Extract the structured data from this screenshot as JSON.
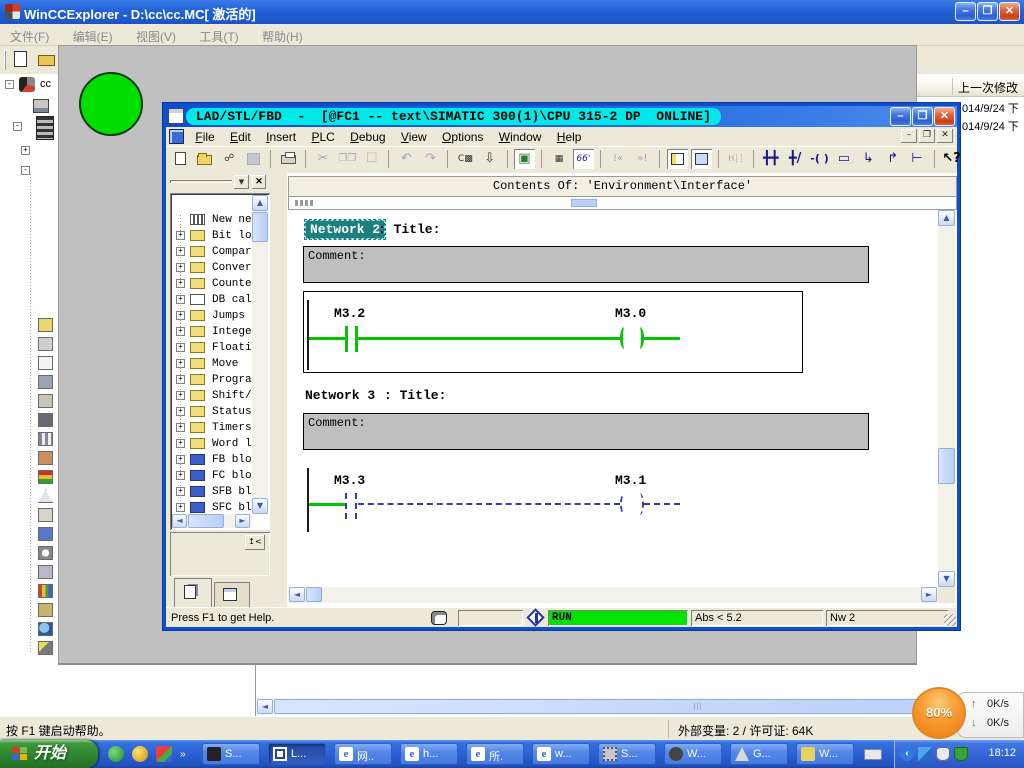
{
  "wincc": {
    "title": "WinCCExplorer - D:\\cc\\cc.MC[ 激活的]",
    "menus": [
      "文件(F)",
      "编辑(E)",
      "视图(V)",
      "工具(T)",
      "帮助(H)"
    ],
    "tree_root_label": "cc",
    "list_header": "上一次修改",
    "list_rows": [
      "014/9/24 下",
      "014/9/24 下"
    ],
    "status_left": "按 F1 键启动帮助。",
    "status_right": "外部变量: 2 / 许可证: 64K"
  },
  "lad": {
    "title": "LAD/STL/FBD  -  [@FC1 -- text\\SIMATIC 300(1)\\CPU 315-2 DP  ONLINE]",
    "menus": [
      "File",
      "Edit",
      "Insert",
      "PLC",
      "Debug",
      "View",
      "Options",
      "Window",
      "Help"
    ],
    "contents_header": "Contents Of: 'Environment\\Interface'",
    "toolbar_icons": [
      "new",
      "open",
      "network-settings",
      "save",
      "print",
      "cut",
      "copy",
      "paste",
      "undo",
      "redo",
      "call-structure",
      "download",
      "monitor-toggle",
      "address-toggle",
      "monitor-glasses",
      "previous-error",
      "next-error",
      "overview",
      "detail-view",
      "new-network",
      "contact-no",
      "contact-nc",
      "coil",
      "empty-box",
      "open-branch",
      "close-branch",
      "horizontal-line",
      "help-pointer"
    ],
    "catalog": {
      "items": [
        {
          "label": "New net",
          "icon": "new-network"
        },
        {
          "label": "Bit log",
          "icon": "bit-logic"
        },
        {
          "label": "Compara",
          "icon": "comparator"
        },
        {
          "label": "Convert",
          "icon": "converter"
        },
        {
          "label": "Counter",
          "icon": "counter"
        },
        {
          "label": "DB call",
          "icon": "db-call"
        },
        {
          "label": "Jumps",
          "icon": "jumps"
        },
        {
          "label": "Integer",
          "icon": "integer-fct"
        },
        {
          "label": "Floatin",
          "icon": "float-fct"
        },
        {
          "label": "Move",
          "icon": "move"
        },
        {
          "label": "Program",
          "icon": "program-control"
        },
        {
          "label": "Shift/R",
          "icon": "shift-rotate"
        },
        {
          "label": "Status",
          "icon": "status-bits"
        },
        {
          "label": "Timers",
          "icon": "timers"
        },
        {
          "label": "Word lo",
          "icon": "word-logic"
        },
        {
          "label": "FB bloc",
          "icon": "fb-blocks"
        },
        {
          "label": "FC bloc",
          "icon": "fc-blocks"
        },
        {
          "label": "SFB blo",
          "icon": "sfb-blocks"
        },
        {
          "label": "SFC blo",
          "icon": "sfc-blocks"
        }
      ]
    },
    "networks": [
      {
        "name": "Network 2",
        "suffix": ": Title:",
        "comment": "Comment:",
        "contact_label": "M3.2",
        "coil_label": "M3.0"
      },
      {
        "name": "Network 3",
        "suffix": ": Title:",
        "comment": "Comment:",
        "contact_label": "M3.3",
        "coil_label": "M3.1"
      }
    ],
    "status": {
      "help": "Press F1 to get Help.",
      "run": "RUN",
      "abs": "Abs < 5.2",
      "nw": "Nw 2"
    }
  },
  "overlay": {
    "percent": "80%",
    "up_speed": "0K/s",
    "down_speed": "0K/s"
  },
  "taskbar": {
    "start_label": "开始",
    "buttons": [
      {
        "label": "S..."
      },
      {
        "label": "L..."
      },
      {
        "label": "网.."
      },
      {
        "label": "h..."
      },
      {
        "label": "所."
      },
      {
        "label": "w..."
      },
      {
        "label": "S..."
      },
      {
        "label": "W..."
      },
      {
        "label": "G..."
      },
      {
        "label": "W..."
      }
    ],
    "clock": "18:12"
  }
}
